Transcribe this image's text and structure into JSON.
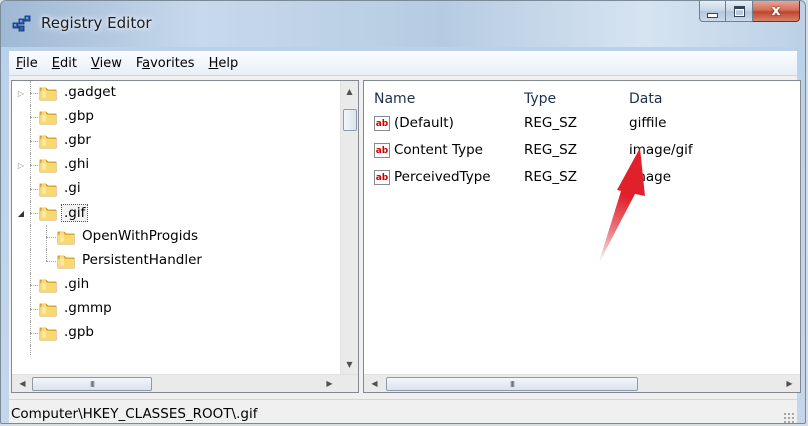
{
  "window": {
    "title": "Registry Editor",
    "close_glyph": "x"
  },
  "menu": [
    {
      "accel": "F",
      "rest": "ile"
    },
    {
      "accel": "E",
      "rest": "dit"
    },
    {
      "accel": "V",
      "rest": "iew"
    },
    {
      "pre": "F",
      "accel": "a",
      "rest": "vorites"
    },
    {
      "accel": "H",
      "rest": "elp"
    }
  ],
  "tree": {
    "items": [
      {
        "label": ".gadget",
        "expander": "closed"
      },
      {
        "label": ".gbp",
        "expander": "none"
      },
      {
        "label": ".gbr",
        "expander": "none"
      },
      {
        "label": ".ghi",
        "expander": "closed"
      },
      {
        "label": ".gi",
        "expander": "none"
      },
      {
        "label": ".gif",
        "expander": "open",
        "selected": true
      },
      {
        "label": "OpenWithProgids",
        "child": true
      },
      {
        "label": "PersistentHandler",
        "child": true
      },
      {
        "label": ".gih",
        "expander": "none"
      },
      {
        "label": ".gmmp",
        "expander": "none"
      },
      {
        "label": ".gpb",
        "expander": "none"
      }
    ]
  },
  "list": {
    "columns": [
      "Name",
      "Type",
      "Data"
    ],
    "rows": [
      {
        "name": "(Default)",
        "type": "REG_SZ",
        "data": "giffile"
      },
      {
        "name": "Content Type",
        "type": "REG_SZ",
        "data": "image/gif"
      },
      {
        "name": "PerceivedType",
        "type": "REG_SZ",
        "data": "image"
      }
    ],
    "value_icon_text": "ab"
  },
  "scroll": {
    "thumb_grip": "III"
  },
  "status": {
    "path": "Computer\\HKEY_CLASSES_ROOT\\.gif"
  },
  "colors": {
    "annotation_arrow": "#e0202a",
    "folder": "#f2c13c"
  }
}
